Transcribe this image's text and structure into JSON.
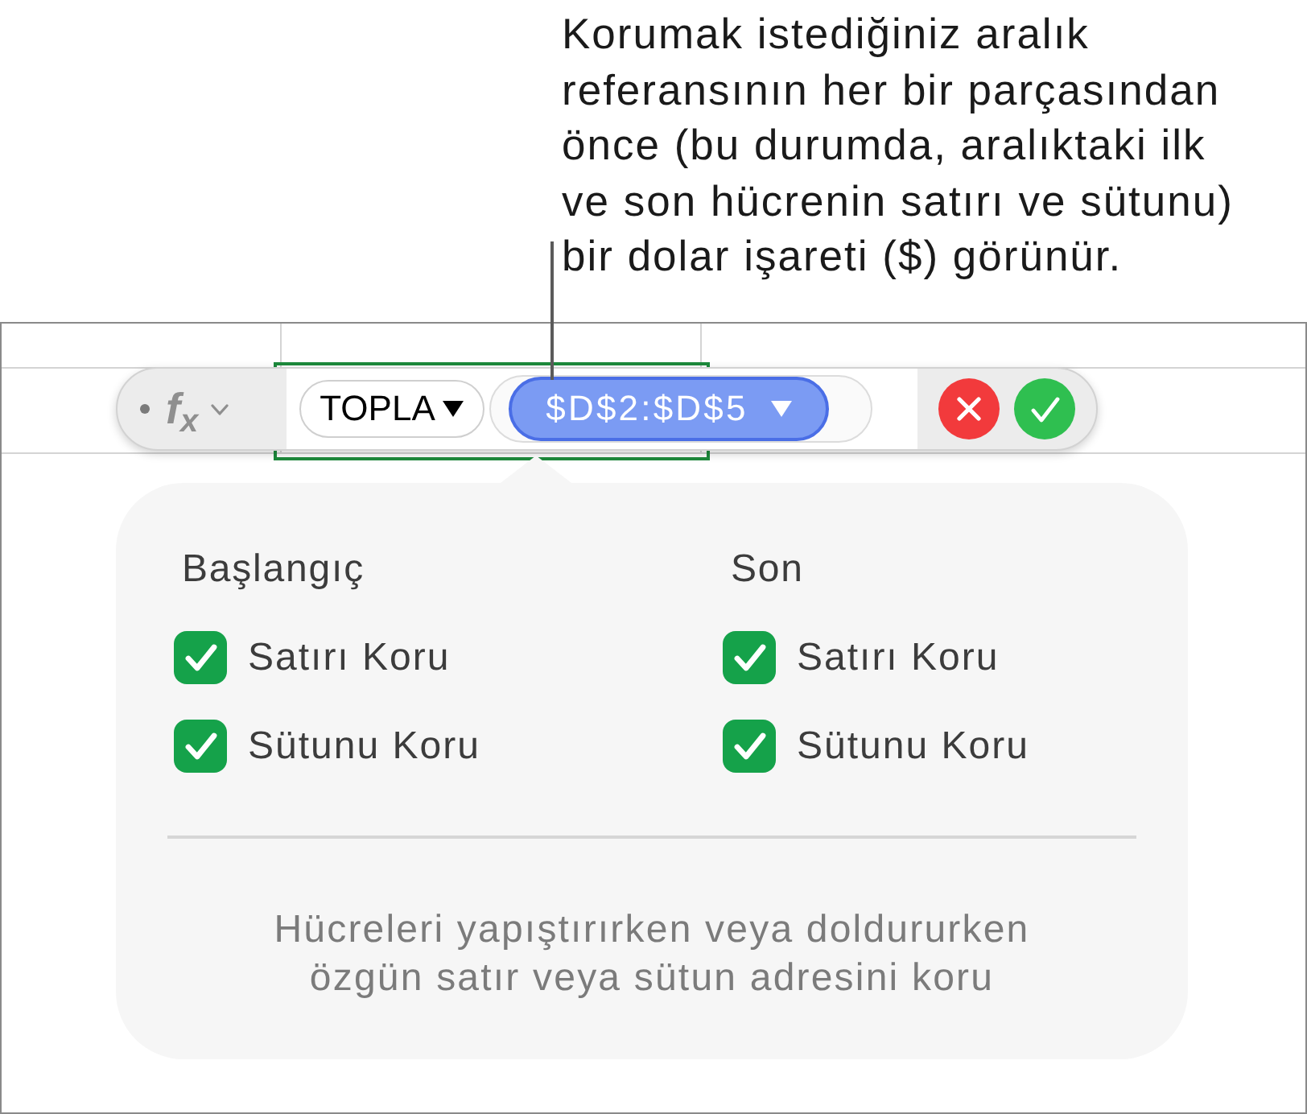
{
  "callout": {
    "lines": [
      "Korumak istediğiniz aralık",
      "referansının her bir parçasından",
      "önce (bu durumda, aralıktaki ilk",
      "ve son hücrenin satırı ve sütunu)",
      "bir dolar işareti ($) görünür."
    ]
  },
  "formula_bar": {
    "function_symbol": "f$_{x}$",
    "function": {
      "label": "TOPLA"
    },
    "arguments": [
      {
        "label": "$D$2:$D$5",
        "selected": true
      }
    ]
  },
  "popover": {
    "groups": [
      {
        "heading": "Başlangıç",
        "options": [
          {
            "label": "Satırı Koru",
            "checked": true
          },
          {
            "label": "Sütunu Koru",
            "checked": true
          }
        ]
      },
      {
        "heading": "Son",
        "options": [
          {
            "label": "Satırı Koru",
            "checked": true
          },
          {
            "label": "Sütunu Koru",
            "checked": true
          }
        ]
      }
    ],
    "note": {
      "lines": [
        "Hücreleri yapıştırırken veya doldururken",
        "özgün satır veya sütun adresini koru"
      ]
    }
  }
}
